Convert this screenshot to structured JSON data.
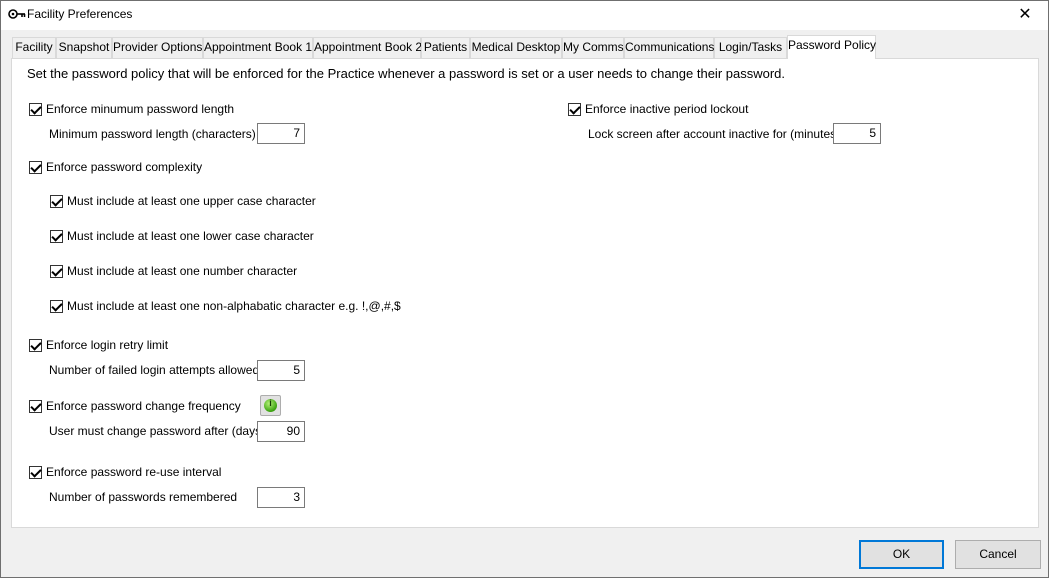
{
  "window": {
    "title": "Facility Preferences"
  },
  "tabs": [
    {
      "label": "Facility"
    },
    {
      "label": "Snapshot"
    },
    {
      "label": "Provider Options"
    },
    {
      "label": "Appointment Book 1"
    },
    {
      "label": "Appointment Book 2"
    },
    {
      "label": "Patients"
    },
    {
      "label": "Medical Desktop"
    },
    {
      "label": "My Comms"
    },
    {
      "label": "Communications"
    },
    {
      "label": "Login/Tasks"
    },
    {
      "label": "Password Policy"
    }
  ],
  "active_tab": "Password Policy",
  "policy": {
    "intro": "Set the password policy that will be enforced for the Practice whenever a password is set or a user needs to change their password.",
    "min_length": {
      "label": "Enforce minumum password length",
      "checked": true,
      "field_label": "Minimum password length (characters)",
      "value": "7"
    },
    "complexity": {
      "label": "Enforce password complexity",
      "checked": true,
      "upper": "Must include at least one upper case character",
      "lower": "Must include at least one lower case character",
      "number": "Must include at least one number character",
      "nonalpha": "Must include at least one non-alphabatic character e.g. !,@,#,$"
    },
    "retry": {
      "label": "Enforce login retry limit",
      "checked": true,
      "field_label": "Number of failed login attempts allowed",
      "value": "5"
    },
    "change_freq": {
      "label": "Enforce password change frequency",
      "checked": true,
      "field_label": "User must change password after (days)",
      "value": "90"
    },
    "reuse": {
      "label": "Enforce password re-use interval",
      "checked": true,
      "field_label": "Number of passwords remembered",
      "value": "3"
    },
    "lockout": {
      "label": "Enforce inactive period lockout",
      "checked": true,
      "field_label": "Lock screen after account inactive for (minutes)",
      "value": "5"
    }
  },
  "buttons": {
    "ok": "OK",
    "cancel": "Cancel"
  },
  "colors": {
    "accent": "#0078d7",
    "info_icon": "#3aa20f"
  }
}
